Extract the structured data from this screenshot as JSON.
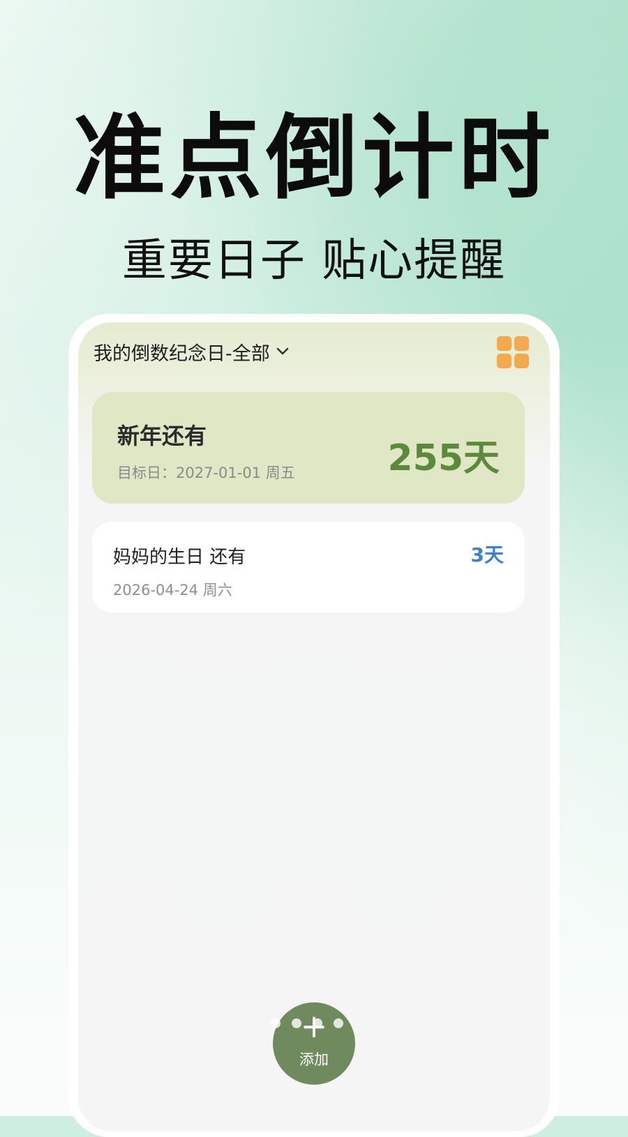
{
  "hero": {
    "title": "准点倒计时",
    "subtitle": "重要日子 贴心提醒"
  },
  "app": {
    "header_title": "我的倒数纪念日-全部",
    "header_icons": [
      "chevron-down-icon",
      "grid-icon"
    ],
    "main_card": {
      "title": "新年还有",
      "date": "目标日：2027-01-01 周五",
      "days": "255天"
    },
    "items": [
      {
        "title": "妈妈的生日 还有",
        "date": "2026-04-24 周六",
        "days": "3天"
      }
    ],
    "fab": {
      "label": "添加",
      "icon": "plus-icon"
    },
    "colors": {
      "accent_orange": "#f4a94d",
      "main_card_bg": "#dfe7c5",
      "main_days": "#5a8a3a",
      "item_days": "#3c7fd6",
      "fab_bg": "#6f8a5c"
    }
  }
}
